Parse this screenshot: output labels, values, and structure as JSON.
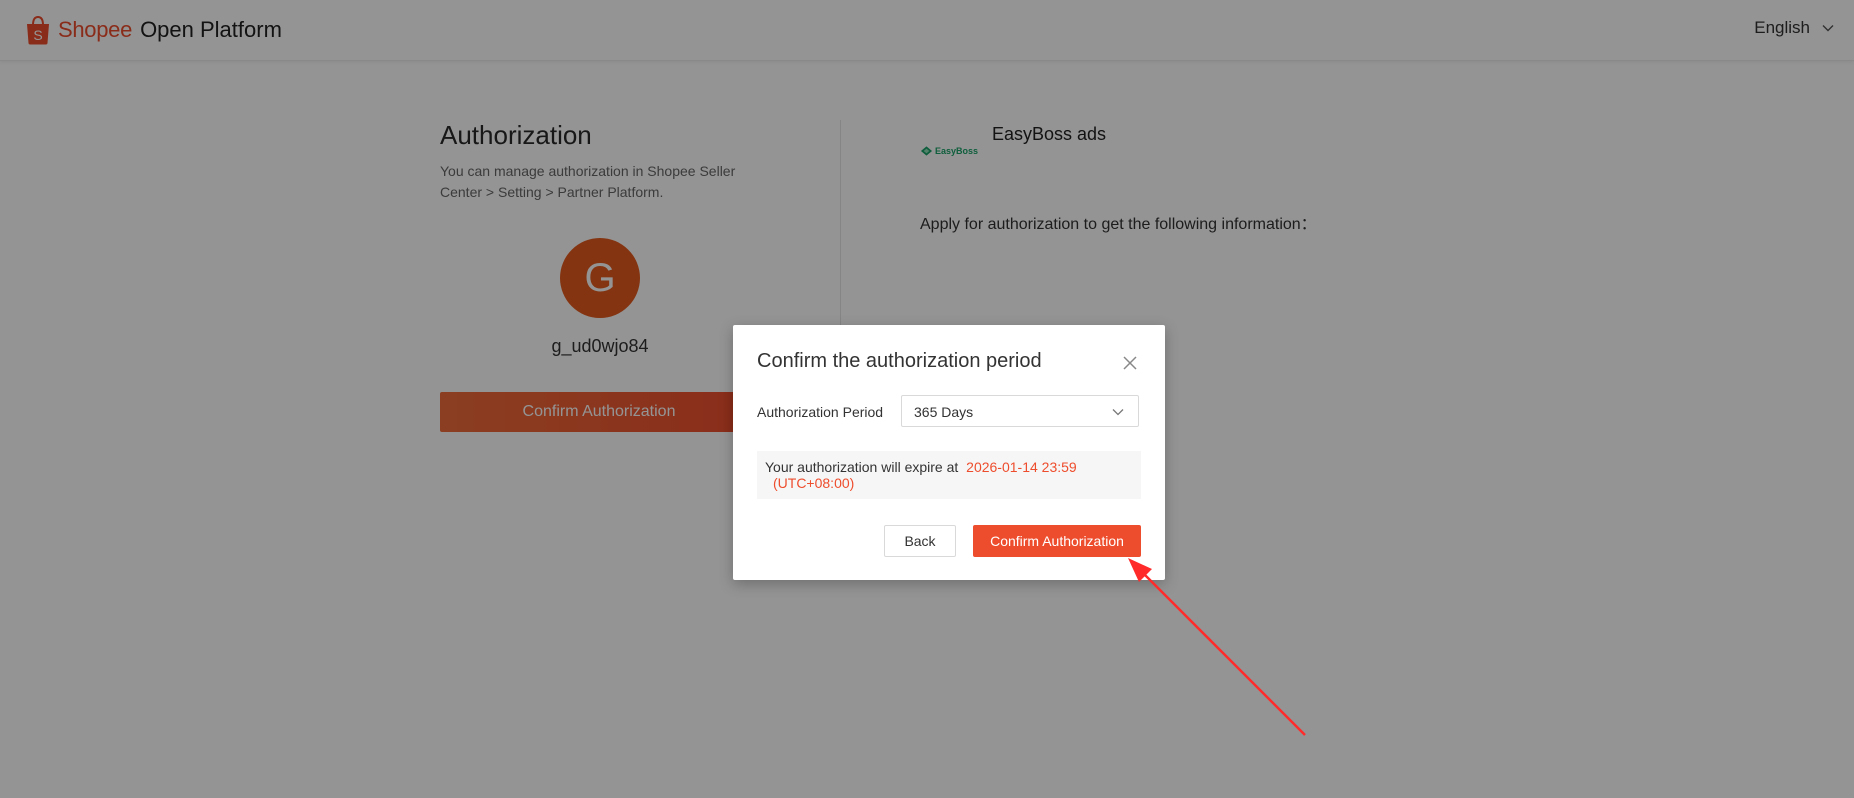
{
  "header": {
    "brand_shopee": "Shopee",
    "brand_rest": "Open Platform",
    "language": "English"
  },
  "left_panel": {
    "title": "Authorization",
    "description": "You can manage authorization in Shopee Seller Center > Setting > Partner Platform.",
    "avatar_letter": "G",
    "username": "g_ud0wjo84",
    "confirm_label": "Confirm Authorization"
  },
  "right_panel": {
    "logo_text": "EasyBoss",
    "app_name": "EasyBoss ads",
    "apply_text": "Apply for authorization to get the following information："
  },
  "modal": {
    "title": "Confirm the authorization period",
    "period_label": "Authorization Period",
    "period_value": "365 Days",
    "expiry_prefix": "Your authorization will expire at",
    "expiry_date": "2026-01-14 23:59",
    "expiry_tz": "(UTC+08:00)",
    "back_label": "Back",
    "confirm_label": "Confirm Authorization"
  },
  "icons": {
    "brand": "shopee-bag-icon",
    "language_dropdown": "chevron-down-icon",
    "close": "close-icon",
    "select_dropdown": "chevron-down-icon",
    "annotation": "red-arrow-annotation"
  },
  "colors": {
    "brand": "#ee4d2d",
    "avatar": "#e45a1c",
    "logo_green": "#1aa36a",
    "annotation_arrow": "#ff2a2a"
  }
}
